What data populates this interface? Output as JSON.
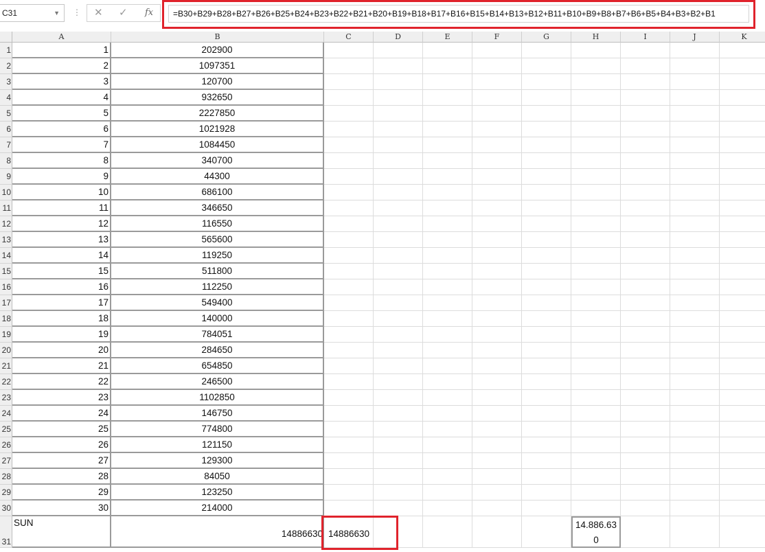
{
  "toolbar": {
    "name_box": "C31",
    "formula": "=B30+B29+B28+B27+B26+B25+B24+B23+B22+B21+B20+B19+B18+B17+B16+B15+B14+B13+B12+B11+B10+B9+B8+B7+B6+B5+B4+B3+B2+B1",
    "cancel_symbol": "✕",
    "enter_symbol": "✓",
    "fx_symbol": "fx",
    "colors": {
      "highlight": "#e0232c",
      "header_bg": "#efefef"
    }
  },
  "sheet": {
    "columns": [
      "A",
      "B",
      "C",
      "D",
      "E",
      "F",
      "G",
      "H",
      "I",
      "J",
      "K"
    ],
    "row_numbers": [
      "1",
      "2",
      "3",
      "4",
      "5",
      "6",
      "7",
      "8",
      "9",
      "10",
      "11",
      "12",
      "13",
      "14",
      "15",
      "16",
      "17",
      "18",
      "19",
      "20",
      "21",
      "22",
      "23",
      "24",
      "25",
      "26",
      "27",
      "28",
      "29",
      "30",
      "31"
    ],
    "rows": [
      {
        "a": "1",
        "b": "202900"
      },
      {
        "a": "2",
        "b": "1097351"
      },
      {
        "a": "3",
        "b": "120700"
      },
      {
        "a": "4",
        "b": "932650"
      },
      {
        "a": "5",
        "b": "2227850"
      },
      {
        "a": "6",
        "b": "1021928"
      },
      {
        "a": "7",
        "b": "1084450"
      },
      {
        "a": "8",
        "b": "340700"
      },
      {
        "a": "9",
        "b": "44300"
      },
      {
        "a": "10",
        "b": "686100"
      },
      {
        "a": "11",
        "b": "346650"
      },
      {
        "a": "12",
        "b": "116550"
      },
      {
        "a": "13",
        "b": "565600"
      },
      {
        "a": "14",
        "b": "119250"
      },
      {
        "a": "15",
        "b": "511800"
      },
      {
        "a": "16",
        "b": "112250"
      },
      {
        "a": "17",
        "b": "549400"
      },
      {
        "a": "18",
        "b": "140000"
      },
      {
        "a": "19",
        "b": "784051"
      },
      {
        "a": "20",
        "b": "284650"
      },
      {
        "a": "21",
        "b": "654850"
      },
      {
        "a": "22",
        "b": "246500"
      },
      {
        "a": "23",
        "b": "1102850"
      },
      {
        "a": "24",
        "b": "146750"
      },
      {
        "a": "25",
        "b": "774800"
      },
      {
        "a": "26",
        "b": "121150"
      },
      {
        "a": "27",
        "b": "129300"
      },
      {
        "a": "28",
        "b": "84050"
      },
      {
        "a": "29",
        "b": "123250"
      },
      {
        "a": "30",
        "b": "214000"
      }
    ],
    "total_row": {
      "a": "SUN",
      "b": "14886630",
      "c": "14886630",
      "h_line1": "14.886.63",
      "h_line2": "0"
    }
  }
}
